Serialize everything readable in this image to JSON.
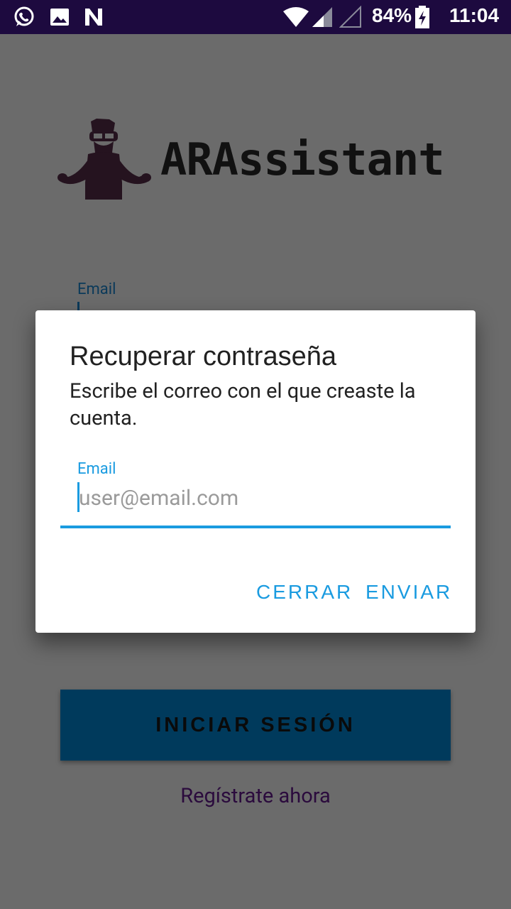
{
  "status_bar": {
    "icons_left": [
      "whatsapp-icon",
      "image-icon",
      "n-app-icon"
    ],
    "battery_percent": "84%",
    "time": "11:04",
    "background_color": "#1d0a3f"
  },
  "app": {
    "title": "ARAssistant",
    "email_label": "Email",
    "login_button": "INICIAR SESIÓN",
    "register_link": "Regístrate ahora",
    "colors": {
      "overlay": "#6b6b6b",
      "login_button_bg": "#003a5c"
    }
  },
  "dialog": {
    "title": "Recuperar contraseña",
    "message": "Escribe el correo con el que creaste la cuenta.",
    "email_label": "Email",
    "email_placeholder": "user@email.com",
    "email_value": "",
    "close_button": "CERRAR",
    "send_button": "ENVIAR",
    "accent_color": "#1a9be0"
  }
}
